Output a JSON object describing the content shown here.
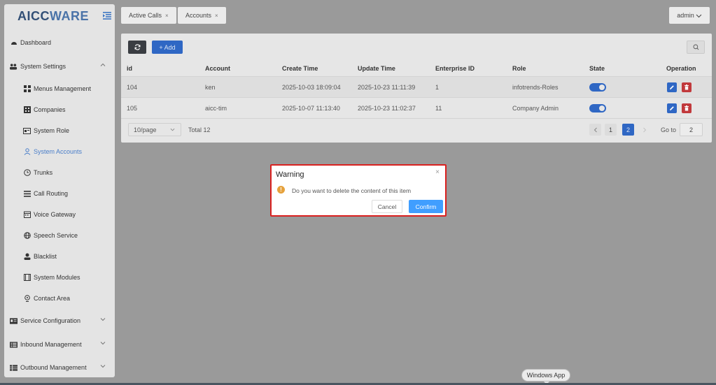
{
  "brand": {
    "logo_part1": "AICC",
    "logo_part2": "WARE"
  },
  "sidebar": {
    "items": [
      {
        "label": "Dashboard",
        "icon": "dashboard-icon"
      },
      {
        "label": "System Settings",
        "icon": "users-cog-icon",
        "expanded": true
      },
      {
        "label": "Menus Management",
        "icon": "grid-icon"
      },
      {
        "label": "Companies",
        "icon": "building-icon"
      },
      {
        "label": "System Role",
        "icon": "role-card-icon"
      },
      {
        "label": "System Accounts",
        "icon": "user-icon",
        "active": true
      },
      {
        "label": "Trunks",
        "icon": "clock-icon"
      },
      {
        "label": "Call Routing",
        "icon": "list-icon"
      },
      {
        "label": "Voice Gateway",
        "icon": "calendar-icon"
      },
      {
        "label": "Speech Service",
        "icon": "globe-icon"
      },
      {
        "label": "Blacklist",
        "icon": "person-solid-icon"
      },
      {
        "label": "System Modules",
        "icon": "film-icon"
      },
      {
        "label": "Contact Area",
        "icon": "location-pin-icon"
      },
      {
        "label": "Service Configuration",
        "icon": "id-card-icon"
      },
      {
        "label": "Inbound Management",
        "icon": "list-alt-icon"
      },
      {
        "label": "Outbound Management",
        "icon": "table-icon"
      }
    ]
  },
  "header": {
    "tabs": [
      {
        "label": "Active Calls"
      },
      {
        "label": "Accounts"
      }
    ],
    "user": "admin"
  },
  "toolbar": {
    "add_label": "+ Add"
  },
  "table": {
    "columns": [
      "id",
      "Account",
      "Create Time",
      "Update Time",
      "Enterprise ID",
      "Role",
      "State",
      "Operation"
    ],
    "rows": [
      {
        "id": "104",
        "account": "ken",
        "create_time": "2025-10-03 18:09:04",
        "update_time": "2025-10-23 11:11:39",
        "enterprise_id": "1",
        "role": "infotrends-Roles",
        "state": true
      },
      {
        "id": "105",
        "account": "aicc-tim",
        "create_time": "2025-10-07 11:13:40",
        "update_time": "2025-10-23 11:02:37",
        "enterprise_id": "11",
        "role": "Company Admin",
        "state": true
      }
    ]
  },
  "pagination": {
    "page_size": "10/page",
    "total": "Total 12",
    "pages": [
      "1",
      "2"
    ],
    "current": "2",
    "goto_label": "Go to",
    "goto_value": "2"
  },
  "dialog": {
    "title": "Warning",
    "message": "Do you want to delete the content of this item",
    "cancel": "Cancel",
    "confirm": "Confirm"
  },
  "tooltip": "Windows App",
  "colors": {
    "primary": "#2f67c4",
    "danger": "#c1393c",
    "warning": "#e6a23c",
    "highlight_border": "#d9201f"
  }
}
